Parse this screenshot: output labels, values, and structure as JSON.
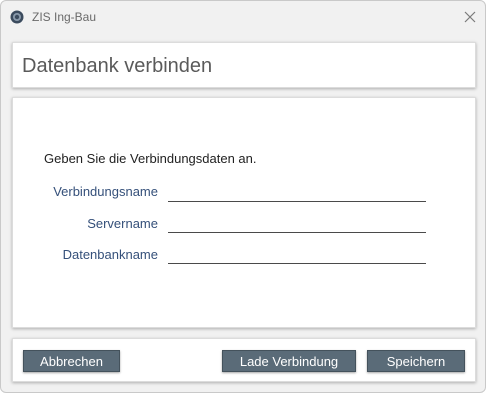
{
  "window": {
    "title": "ZIS Ing-Bau",
    "app_icon": "circle-logo-icon",
    "close_icon": "close-x-icon"
  },
  "header": {
    "title": "Datenbank verbinden"
  },
  "form": {
    "instruction": "Geben Sie die Verbindungsdaten an.",
    "fields": [
      {
        "label": "Verbindungsname",
        "value": ""
      },
      {
        "label": "Servername",
        "value": ""
      },
      {
        "label": "Datenbankname",
        "value": ""
      }
    ]
  },
  "footer": {
    "cancel_label": "Abbrechen",
    "load_label": "Lade Verbindung",
    "save_label": "Speichern"
  },
  "colors": {
    "button_bg": "#5a6b78",
    "label_text": "#35507a",
    "panel_bg": "#ffffff",
    "window_bg": "#f1f1f1"
  }
}
